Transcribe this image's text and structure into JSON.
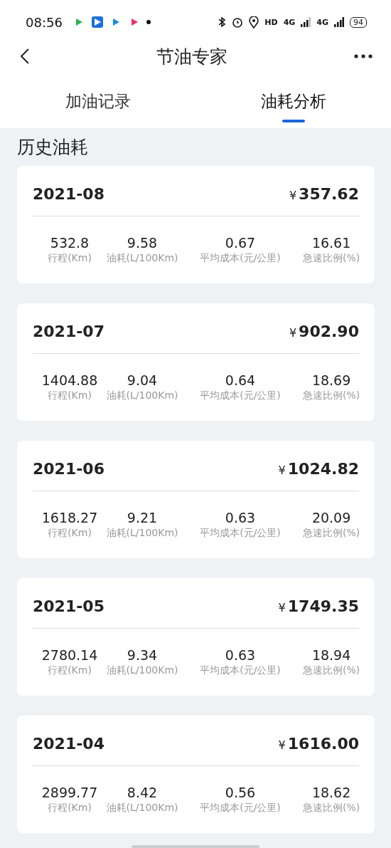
{
  "status_bar": {
    "time": "08:56",
    "network": [
      "HD",
      "4G",
      "4G"
    ],
    "battery": "94"
  },
  "header": {
    "title": "节油专家"
  },
  "tabs": [
    {
      "label": "加油记录",
      "selected": false
    },
    {
      "label": "油耗分析",
      "selected": true
    }
  ],
  "section_title": "历史油耗",
  "records": [
    {
      "month": "2021-08",
      "currency": "¥",
      "amount": "357.62",
      "metrics": [
        {
          "value": "532.8",
          "label": "行程(Km)"
        },
        {
          "value": "9.58",
          "label": "油耗(L/100Km)"
        },
        {
          "value": "0.67",
          "label": "平均成本(元/公里)"
        },
        {
          "value": "16.61",
          "label": "急速比例(%)"
        }
      ]
    },
    {
      "month": "2021-07",
      "currency": "¥",
      "amount": "902.90",
      "metrics": [
        {
          "value": "1404.88",
          "label": "行程(Km)"
        },
        {
          "value": "9.04",
          "label": "油耗(L/100Km)"
        },
        {
          "value": "0.64",
          "label": "平均成本(元/公里)"
        },
        {
          "value": "18.69",
          "label": "急速比例(%)"
        }
      ]
    },
    {
      "month": "2021-06",
      "currency": "¥",
      "amount": "1024.82",
      "metrics": [
        {
          "value": "1618.27",
          "label": "行程(Km)"
        },
        {
          "value": "9.21",
          "label": "油耗(L/100Km)"
        },
        {
          "value": "0.63",
          "label": "平均成本(元/公里)"
        },
        {
          "value": "20.09",
          "label": "急速比例(%)"
        }
      ]
    },
    {
      "month": "2021-05",
      "currency": "¥",
      "amount": "1749.35",
      "metrics": [
        {
          "value": "2780.14",
          "label": "行程(Km)"
        },
        {
          "value": "9.34",
          "label": "油耗(L/100Km)"
        },
        {
          "value": "0.63",
          "label": "平均成本(元/公里)"
        },
        {
          "value": "18.94",
          "label": "急速比例(%)"
        }
      ]
    },
    {
      "month": "2021-04",
      "currency": "¥",
      "amount": "1616.00",
      "metrics": [
        {
          "value": "2899.77",
          "label": "行程(Km)"
        },
        {
          "value": "8.42",
          "label": "油耗(L/100Km)"
        },
        {
          "value": "0.56",
          "label": "平均成本(元/公里)"
        },
        {
          "value": "18.62",
          "label": "急速比例(%)"
        }
      ]
    }
  ]
}
